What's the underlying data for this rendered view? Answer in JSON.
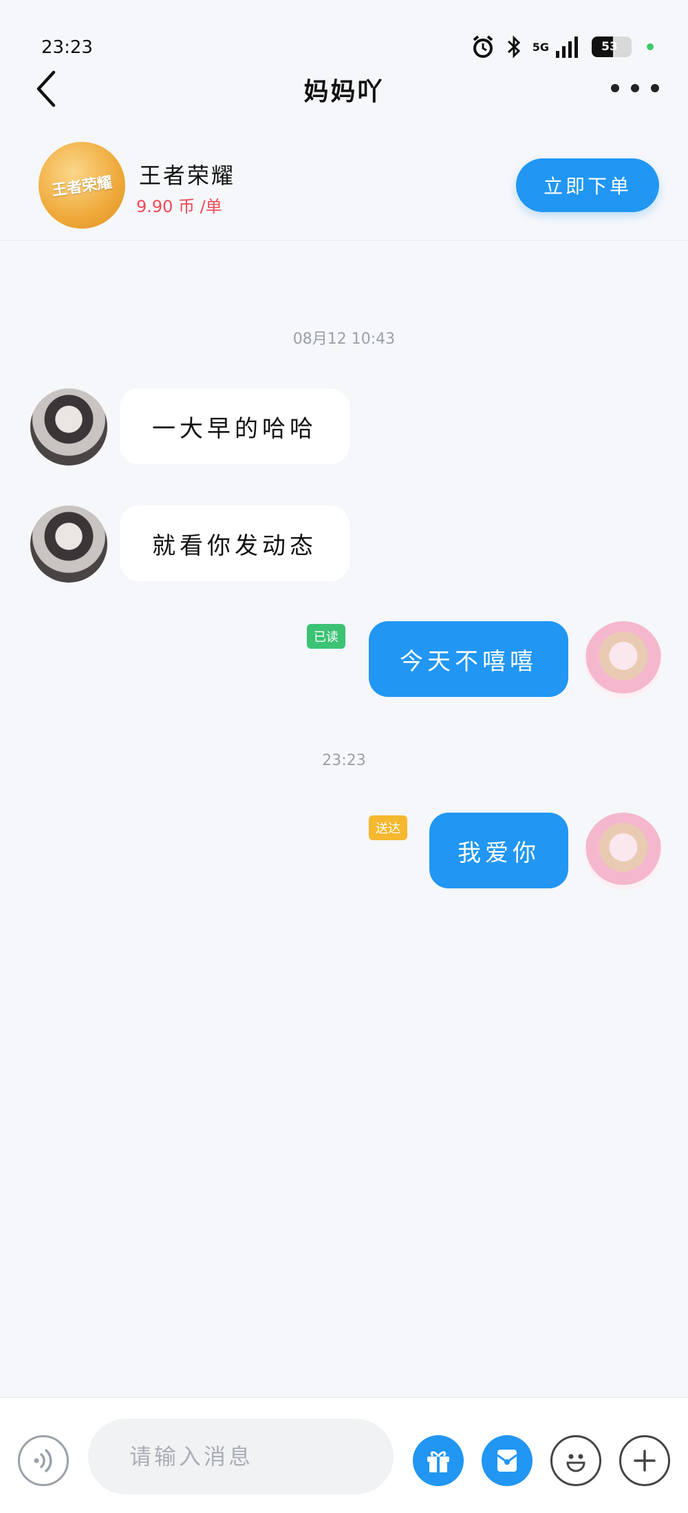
{
  "status_bar": {
    "time": "23:23",
    "network": "5G",
    "battery": "53",
    "battery_level": 0.53,
    "icons": [
      "alarm-icon",
      "bluetooth-icon",
      "signal-icon",
      "battery-icon"
    ]
  },
  "nav": {
    "back_icon": "chevron-left-icon",
    "title": "妈妈吖",
    "more_icon": "more-dots-icon"
  },
  "product": {
    "logo_text": "王者荣耀",
    "name": "王者荣耀",
    "price": "9.90 币 /单",
    "order_button": "立即下单"
  },
  "messages": {
    "timestamp_1": "08月12  10:43",
    "msg_1": "一大早的哈哈",
    "msg_2": "就看你发动态",
    "msg_3": "今天不嘻嘻",
    "msg_3_status": "已读",
    "timestamp_2": "23:23",
    "msg_4": "我爱你",
    "msg_4_status": "送达"
  },
  "input_bar": {
    "placeholder": "请输入消息",
    "icons": [
      "voice-icon",
      "gift-icon",
      "red-envelope-icon",
      "emoji-icon",
      "plus-icon"
    ]
  },
  "colors": {
    "accent": "#2196f3",
    "price": "#f04856",
    "read_badge": "#3cc274",
    "sent_badge": "#f5b82e",
    "background": "#f5f7fa"
  }
}
